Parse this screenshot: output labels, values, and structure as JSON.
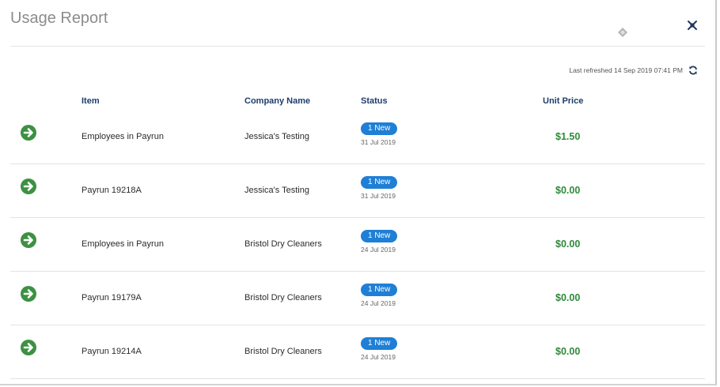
{
  "window": {
    "title": "Usage Report"
  },
  "toolbar": {
    "last_refreshed": "Last refreshed 14 Sep 2019 07:41 PM"
  },
  "table": {
    "columns": {
      "item": "Item",
      "company": "Company Name",
      "status": "Status",
      "unit_price": "Unit Price"
    },
    "rows": [
      {
        "item": "Employees in Payrun",
        "company": "Jessica's Testing",
        "badge": "1 New",
        "date": "31 Jul 2019",
        "price": "$1.50"
      },
      {
        "item": "Payrun 19218A",
        "company": "Jessica's Testing",
        "badge": "1 New",
        "date": "31 Jul 2019",
        "price": "$0.00"
      },
      {
        "item": "Employees in Payrun",
        "company": "Bristol Dry Cleaners",
        "badge": "1 New",
        "date": "24 Jul 2019",
        "price": "$0.00"
      },
      {
        "item": "Payrun 19179A",
        "company": "Bristol Dry Cleaners",
        "badge": "1 New",
        "date": "24 Jul 2019",
        "price": "$0.00"
      },
      {
        "item": "Payrun 19214A",
        "company": "Bristol Dry Cleaners",
        "badge": "1 New",
        "date": "24 Jul 2019",
        "price": "$0.00"
      }
    ]
  },
  "icons": {
    "close": "collapse-arrows-icon",
    "drag": "move-handle-icon",
    "refresh": "refresh-icon",
    "row_action": "arrow-right-circle-icon"
  },
  "colors": {
    "title": "#8c8c8c",
    "header_text": "#1f3d6b",
    "badge": "#1f7fd6",
    "price": "#2e8a3a",
    "action": "#3c9142"
  }
}
